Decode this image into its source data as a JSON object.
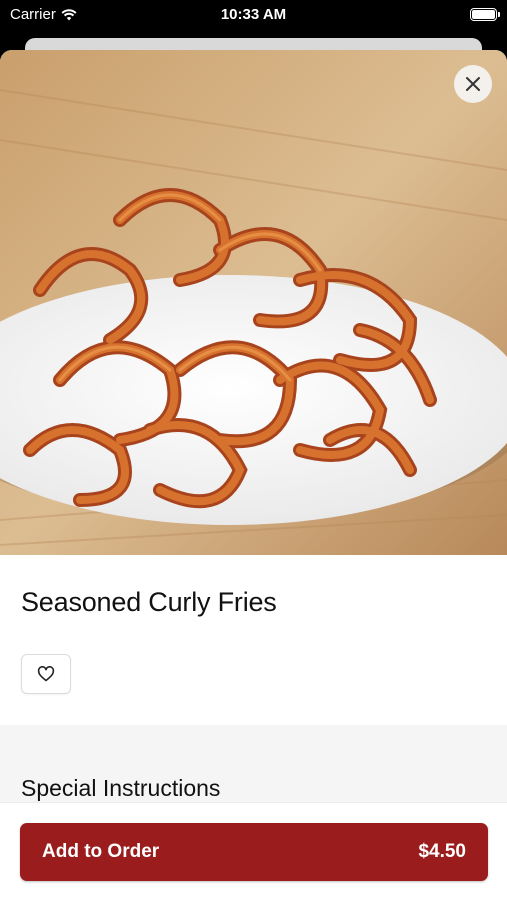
{
  "status_bar": {
    "carrier": "Carrier",
    "time": "10:33 AM"
  },
  "item": {
    "title": "Seasoned Curly Fries",
    "image_icon": "curly-fries-photo"
  },
  "actions": {
    "close_icon": "close-icon",
    "favorite_icon": "heart-outline-icon"
  },
  "instructions": {
    "title": "Special Instructions"
  },
  "order": {
    "label": "Add to Order",
    "price": "$4.50"
  },
  "colors": {
    "accent": "#9a1c1c",
    "section_bg": "#f5f5f5"
  }
}
